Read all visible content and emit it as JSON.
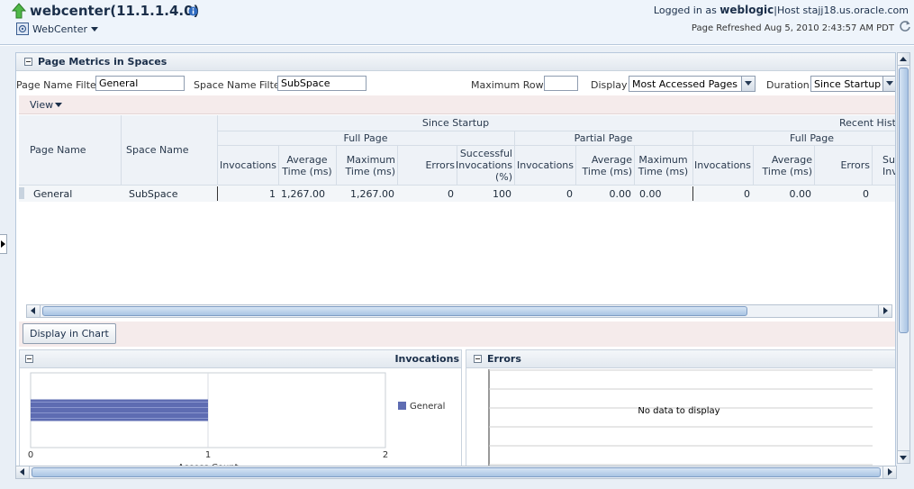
{
  "header": {
    "title": "webcenter(11.1.1.4.0)",
    "menu_label": "WebCenter",
    "logged_in_prefix": "Logged in as",
    "user": "weblogic",
    "host_text": "|Host stajj18.us.oracle.com",
    "page_refreshed": "Page Refreshed Aug 5, 2010 2:43:57 AM PDT"
  },
  "panel": {
    "title": "Page Metrics in Spaces"
  },
  "filters": {
    "page_name_label": "Page Name Filter",
    "page_name_value": "General",
    "space_name_label": "Space Name Filter",
    "space_name_value": "SubSpace",
    "max_rows_label": "Maximum Rows",
    "max_rows_value": "",
    "display_label": "Display",
    "display_value": "Most Accessed Pages",
    "duration_label": "Duration",
    "duration_value": "Since Startup"
  },
  "view_menu": "View",
  "table": {
    "group_since_startup": "Since Startup",
    "group_recent": "Recent Histo",
    "sub_full_page": "Full Page",
    "sub_partial_page": "Partial Page",
    "sub_full_page_recent": "Full Page",
    "col_page_name": "Page Name",
    "col_space_name": "Space Name",
    "col_invocations": "Invocations",
    "col_avg_time_1": "Average",
    "col_avg_time_2": "Time (ms)",
    "col_max_time_1": "Maximum",
    "col_max_time_2": "Time (ms)",
    "col_errors": "Errors",
    "col_success_1": "Successful",
    "col_success_2": "Invocations",
    "col_success_3": "(%)",
    "col_partial_invocations": "Invocations",
    "col_partial_avg_1": "Average",
    "col_partial_avg_2": "Time (ms)",
    "col_partial_max_1": "Maximum",
    "col_partial_max_2": "Time (ms)",
    "col_recent_invocations": "Invocations",
    "col_recent_avg_1": "Average",
    "col_recent_avg_2": "Time (ms)",
    "col_recent_errors": "Errors",
    "col_recent_cut_1": "Su",
    "col_recent_cut_2": "Inv",
    "rows": [
      {
        "page_name": "General",
        "space_name": "SubSpace",
        "invocations": "1",
        "avg_time": "1,267.00",
        "max_time": "1,267.00",
        "errors": "0",
        "success_pct": "100",
        "partial_invocations": "0",
        "partial_avg": "0.00",
        "partial_max": "0.00",
        "recent_invocations": "0",
        "recent_avg": "0.00",
        "recent_errors": "0"
      }
    ]
  },
  "display_chart_button": "Display in Chart",
  "invocations_panel": {
    "title": "Invocations",
    "legend": "General",
    "xlabel": "Access Count",
    "ticks": [
      "0",
      "1",
      "2"
    ]
  },
  "errors_panel": {
    "title": "Errors",
    "empty_message": "No data to display"
  },
  "colors": {
    "bar": "#5e6cb2",
    "header_bg": "#eef4fb",
    "accent": "#1b2f4a"
  },
  "chart_data": {
    "type": "bar",
    "orientation": "horizontal",
    "categories": [
      "General"
    ],
    "values": [
      1
    ],
    "xlabel": "Access Count",
    "xlim": [
      0,
      2
    ],
    "legend": "right",
    "grid": true
  }
}
